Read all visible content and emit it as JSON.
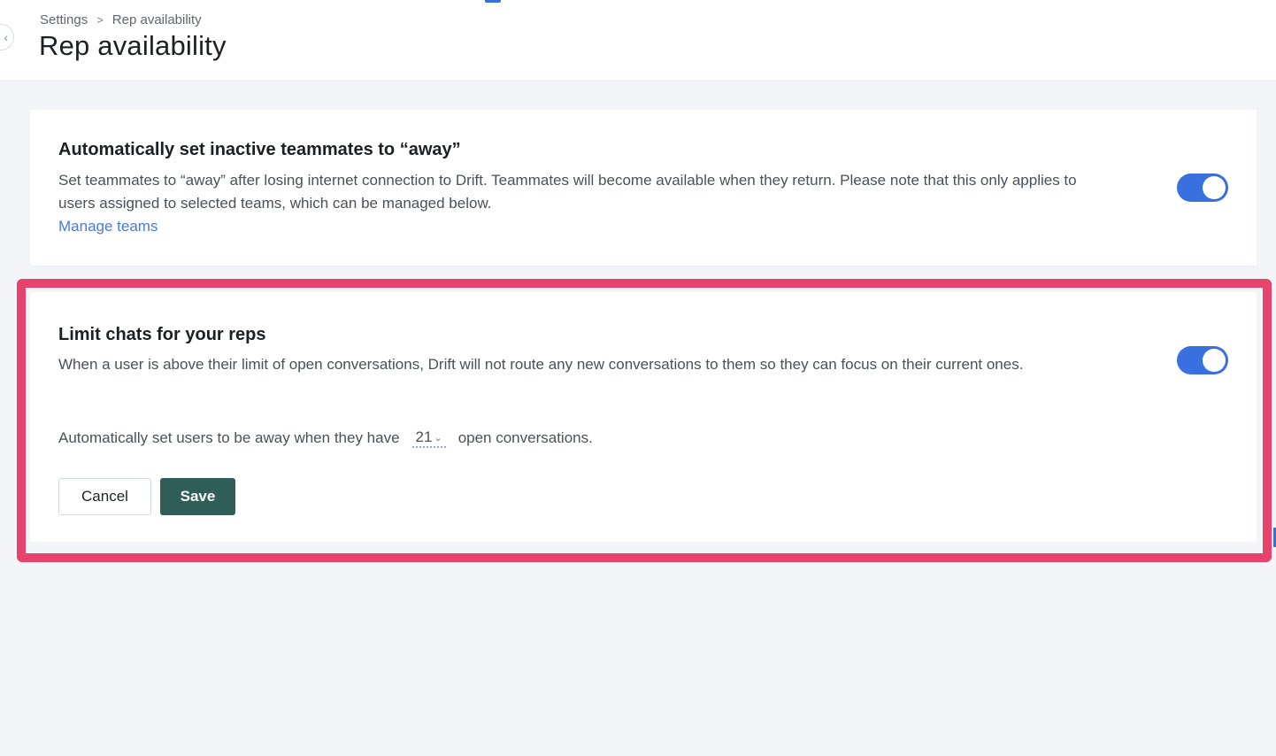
{
  "breadcrumb": {
    "parent": "Settings",
    "separator": ">",
    "current": "Rep availability"
  },
  "page": {
    "title": "Rep availability"
  },
  "cards": {
    "away": {
      "title": "Automatically set inactive teammates to “away”",
      "description": "Set teammates to “away” after losing internet connection to Drift. Teammates will become available when they return. Please note that this only applies to users assigned to selected teams, which can be managed below.",
      "link": "Manage teams",
      "toggle_on": true
    },
    "limit": {
      "title": "Limit chats for your reps",
      "description": "When a user is above their limit of open conversations, Drift will not route any new conversations to them so they can focus on their current ones.",
      "rule_prefix": "Automatically set users to be away when they have",
      "rule_value": "21",
      "rule_suffix": "open conversations.",
      "toggle_on": true,
      "cancel_label": "Cancel",
      "save_label": "Save"
    }
  },
  "icons": {
    "collapse": "chevron-left-icon",
    "select": "chevron-down-icon"
  },
  "colors": {
    "accent": "#3a6fe0",
    "link": "#4a7ae0",
    "save_button": "#2e5e55",
    "highlight": "#e8436c"
  }
}
